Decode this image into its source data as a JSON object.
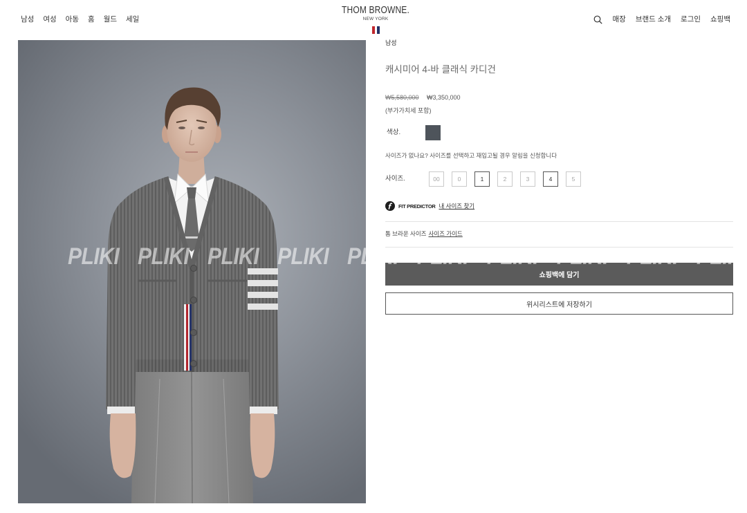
{
  "header": {
    "nav_left": [
      "남성",
      "여성",
      "아동",
      "홈",
      "월드",
      "세일"
    ],
    "logo": {
      "brand": "THOM BROWNE.",
      "city": "NEW YORK"
    },
    "nav_right": [
      "매장",
      "브랜드 소개",
      "로그인",
      "쇼핑백"
    ]
  },
  "image": {
    "watermark": "PLIKI"
  },
  "product": {
    "category": "남성",
    "title": "캐시미어 4-바 클래식 카디건",
    "price_original": "₩5,580,000",
    "price_sale": "₩3,350,000",
    "vat_note": "(부가가치세 포함)",
    "color_label": "색상.",
    "restock_note": "사이즈가 없나요? 사이즈를 선택하고 재입고될 경우 알림을 신청합니다",
    "size_label": "사이즈.",
    "sizes": [
      {
        "label": "00",
        "available": false
      },
      {
        "label": "0",
        "available": false
      },
      {
        "label": "1",
        "available": true
      },
      {
        "label": "2",
        "available": false
      },
      {
        "label": "3",
        "available": false
      },
      {
        "label": "4",
        "available": true
      },
      {
        "label": "5",
        "available": false
      }
    ],
    "fit_predictor": {
      "label": "FIT PREDICTOR",
      "link": "내 사이즈 찾기"
    },
    "size_guide": {
      "text": "톰 브라운 사이즈",
      "link": "사이즈 가이드"
    },
    "add_to_bag": "쇼핑백에 담기",
    "wishlist": "위시리스트에 저장하기"
  },
  "icons": {
    "search": "search-icon",
    "fit_predictor": "fit-predictor-icon",
    "flag": "tricolor-flag-icon"
  },
  "colors": {
    "swatch": "#4e545b",
    "primary_button": "#5b5b5b",
    "flag": [
      "#c0272d",
      "#ffffff",
      "#233066"
    ]
  }
}
